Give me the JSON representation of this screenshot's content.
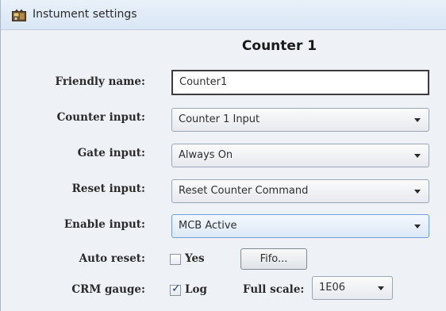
{
  "window": {
    "title": "Instument settings",
    "icon": "instrument-settings-icon"
  },
  "form": {
    "heading": "Counter 1",
    "friendly_name": {
      "label": "Friendly name:",
      "value": "Counter1"
    },
    "counter_input": {
      "label": "Counter input:",
      "selected": "Counter 1 Input"
    },
    "gate_input": {
      "label": "Gate input:",
      "selected": "Always On"
    },
    "reset_input": {
      "label": "Reset input:",
      "selected": "Reset Counter Command"
    },
    "enable_input": {
      "label": "Enable input:",
      "selected": "MCB Active"
    },
    "auto_reset": {
      "label": "Auto reset:",
      "checkbox_label": "Yes",
      "checked": false
    },
    "fifo_button": {
      "label": "Fifo..."
    },
    "crm_gauge": {
      "label": "CRM gauge:",
      "checkbox_label": "Log",
      "checked": true
    },
    "full_scale": {
      "label": "Full scale:",
      "selected": "1E06"
    }
  },
  "colors": {
    "panel_background": "#eef2f7",
    "titlebar_top": "#e9f1fa",
    "active_select_border": "#6f9ed8"
  }
}
